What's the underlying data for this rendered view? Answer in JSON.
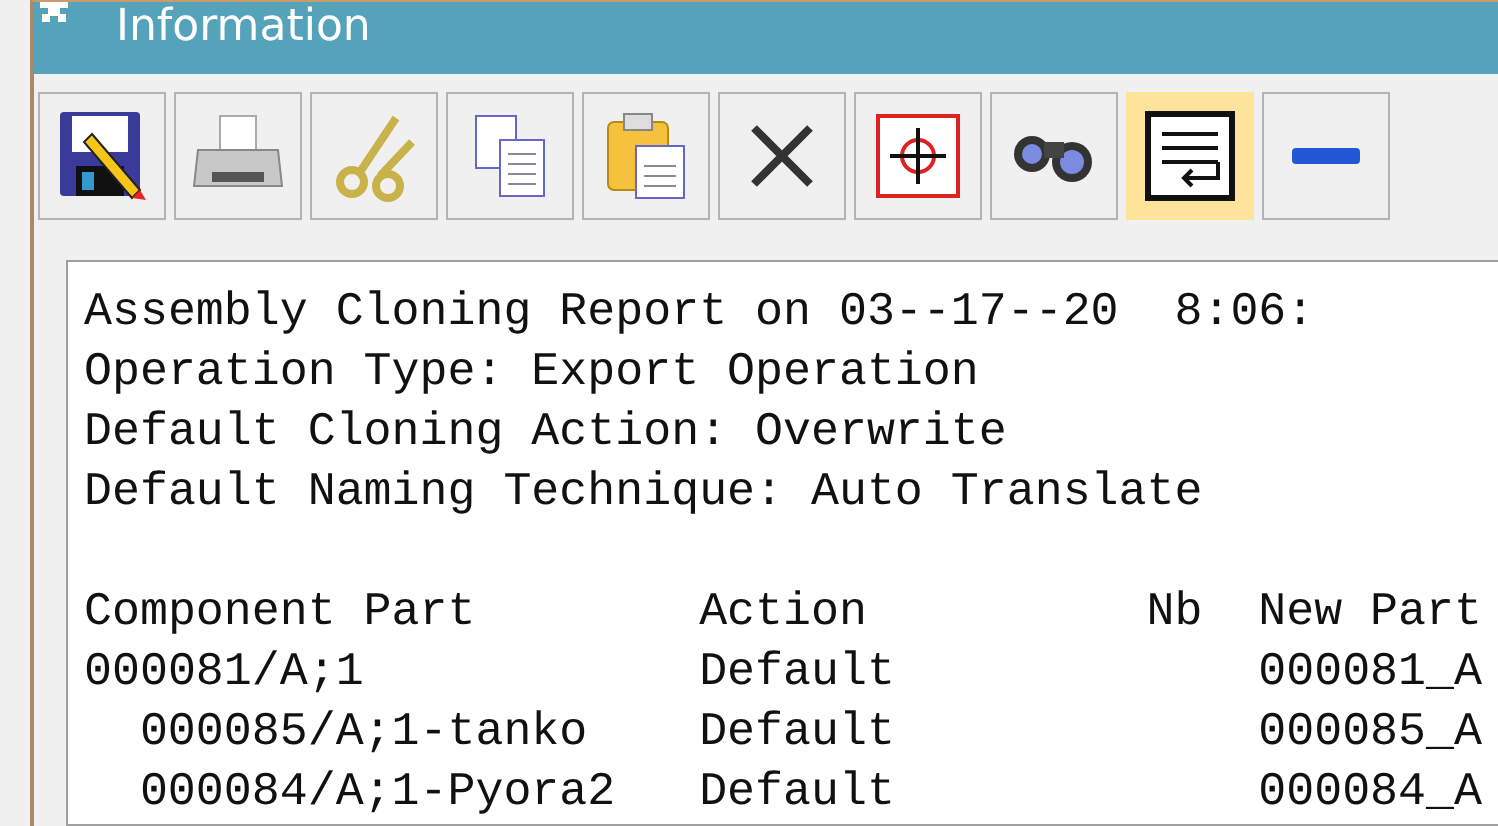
{
  "window": {
    "title": "Information"
  },
  "toolbar": [
    {
      "kind": "save",
      "on": false
    },
    {
      "kind": "print",
      "on": false
    },
    {
      "kind": "cut",
      "on": false
    },
    {
      "kind": "copy",
      "on": false
    },
    {
      "kind": "paste",
      "on": false
    },
    {
      "kind": "delete",
      "on": false
    },
    {
      "kind": "target",
      "on": false
    },
    {
      "kind": "find",
      "on": false
    },
    {
      "kind": "wrap",
      "on": true
    },
    {
      "kind": "minimize",
      "on": false
    }
  ],
  "report": {
    "header_lines": [
      "Assembly Cloning Report on 03--17--20  8:06:",
      "Operation Type: Export Operation",
      "Default Cloning Action: Overwrite",
      "Default Naming Technique: Auto Translate"
    ],
    "table": {
      "columns": [
        "Component Part",
        "Action",
        "Nb",
        "New Part"
      ],
      "rows": [
        {
          "component_part": "000081/A;1",
          "action": "Default",
          "new_part": "000081_A",
          "children": [
            {
              "component_part": "000085/A;1-tanko",
              "action": "Default",
              "new_part": "000085_A"
            },
            {
              "component_part": "000084/A;1-Pyora2",
              "action": "Default",
              "new_part": "000084_A"
            }
          ]
        }
      ]
    }
  }
}
